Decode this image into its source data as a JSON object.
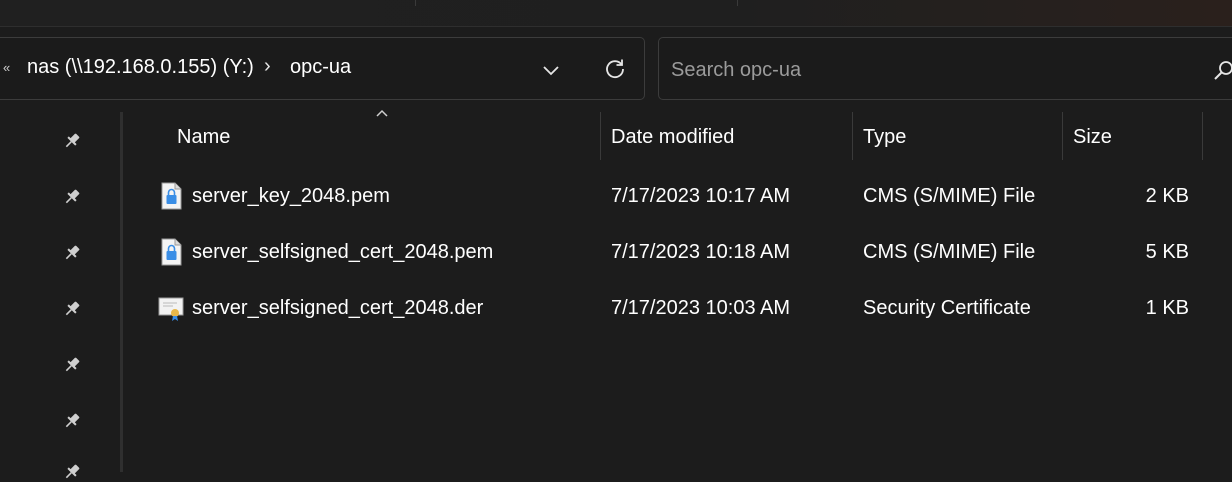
{
  "address_bar": {
    "overflow_icon": "«",
    "crumbs": [
      "nas (\\\\192.168.0.155) (Y:)",
      "opc-ua"
    ],
    "separator": "›",
    "dropdown_icon": "chevron-down-icon",
    "refresh_icon": "refresh-icon"
  },
  "search": {
    "placeholder": "Search opc-ua",
    "icon": "search-icon"
  },
  "nav_pane": {
    "pin_icon": "pin-icon",
    "pinned_count": 7
  },
  "columns": {
    "name": "Name",
    "date_modified": "Date modified",
    "type": "Type",
    "size": "Size",
    "sorted_by": "Name"
  },
  "files": [
    {
      "name": "server_key_2048.pem",
      "date_modified": "7/17/2023 10:17 AM",
      "type": "CMS (S/MIME) File",
      "size": "2 KB",
      "icon": "lock-file-icon"
    },
    {
      "name": "server_selfsigned_cert_2048.pem",
      "date_modified": "7/17/2023 10:18 AM",
      "type": "CMS (S/MIME) File",
      "size": "5 KB",
      "icon": "lock-file-icon"
    },
    {
      "name": "server_selfsigned_cert_2048.der",
      "date_modified": "7/17/2023 10:03 AM",
      "type": "Security Certificate",
      "size": "1 KB",
      "icon": "certificate-icon"
    }
  ],
  "colors": {
    "background": "#1c1c1c",
    "text": "#ffffff",
    "placeholder": "#9b9b9b",
    "border": "#3c3c3c",
    "lock_icon_accent": "#3a8ee6",
    "certificate_icon_accent": "#e8b84a"
  }
}
